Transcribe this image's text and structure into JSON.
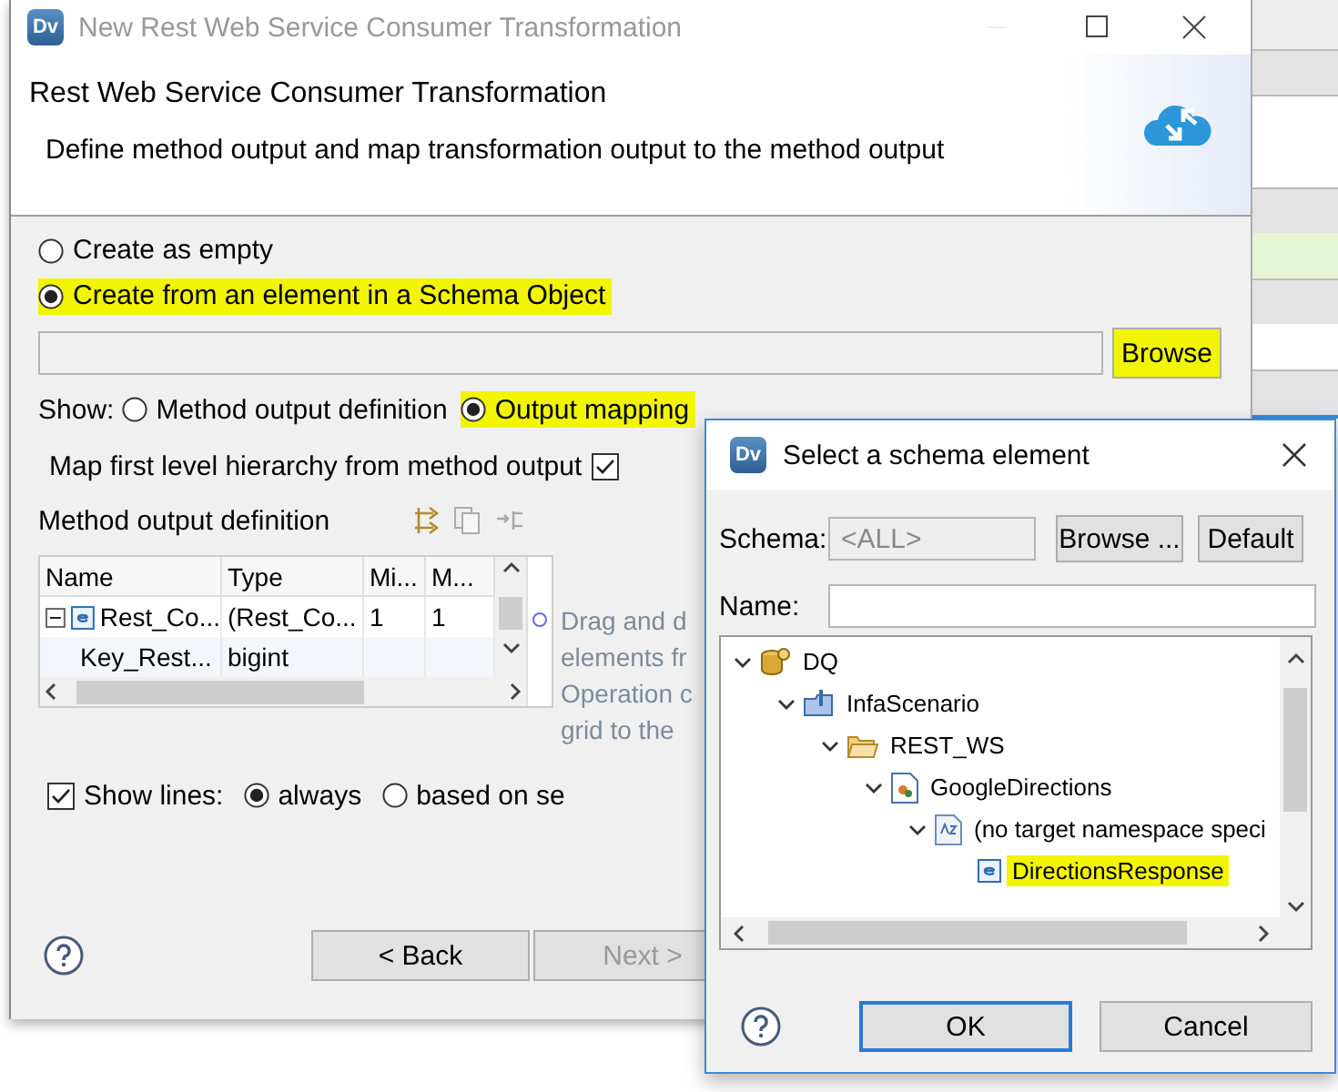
{
  "window": {
    "title": "New Rest Web Service Consumer Transformation",
    "icon": "Dv"
  },
  "header": {
    "title": "Rest Web Service Consumer Transformation",
    "description": "Define method output and map transformation output to the method output"
  },
  "source_options": [
    {
      "label": "Create as empty",
      "selected": false,
      "highlighted": false
    },
    {
      "label": "Create from an element in a Schema Object",
      "selected": true,
      "highlighted": true
    }
  ],
  "browse_button": {
    "label": "Browse",
    "highlighted": true
  },
  "show": {
    "label": "Show:",
    "options": [
      {
        "label": "Method output definition",
        "selected": false,
        "highlighted": false
      },
      {
        "label": "Output mapping",
        "selected": true,
        "highlighted": true
      }
    ]
  },
  "map_first_level": {
    "label": "Map first level hierarchy from method output",
    "checked": true
  },
  "method_output": {
    "title": "Method output definition",
    "columns": [
      "Name",
      "Type",
      "Mi...",
      "M..."
    ],
    "rows": [
      {
        "kind": "element",
        "expanded": true,
        "cells": [
          "Rest_Co...",
          "(Rest_Co...",
          "1",
          "1"
        ]
      },
      {
        "kind": "leaf",
        "cells": [
          "Key_Rest...",
          "bigint"
        ]
      }
    ]
  },
  "hint_lines": [
    "Drag and d",
    "elements fr",
    "Operation c",
    "grid to the"
  ],
  "show_lines": {
    "label": "Show lines:",
    "checked": true,
    "options": [
      {
        "label": "always",
        "selected": true
      },
      {
        "label": "based on se",
        "selected": false
      }
    ]
  },
  "footer": {
    "buttons": [
      {
        "label": "< Back",
        "disabled": false
      },
      {
        "label": "Next >",
        "disabled": true
      }
    ]
  },
  "schema_dialog": {
    "title": "Select a schema element",
    "icon": "Dv",
    "schema_label": "Schema:",
    "schema_value": "<ALL>",
    "browse_label": "Browse ...",
    "default_label": "Default",
    "name_label": "Name:",
    "tree": [
      {
        "label": "DQ",
        "kind": "project",
        "expanded": true,
        "selected": false,
        "highlighted": false,
        "children": [
          {
            "label": "InfaScenario",
            "kind": "folder-info",
            "expanded": true,
            "selected": false,
            "highlighted": false,
            "children": [
              {
                "label": "REST_WS",
                "kind": "folder",
                "expanded": true,
                "selected": false,
                "highlighted": false,
                "children": [
                  {
                    "label": "GoogleDirections",
                    "kind": "schema",
                    "expanded": true,
                    "selected": false,
                    "highlighted": false,
                    "children": [
                      {
                        "label": "(no target namespace speci",
                        "kind": "namespace",
                        "expanded": true,
                        "selected": false,
                        "highlighted": false,
                        "children": [
                          {
                            "label": "DirectionsResponse",
                            "kind": "element",
                            "selected": true,
                            "highlighted": true
                          }
                        ]
                      }
                    ]
                  }
                ]
              }
            ]
          }
        ]
      }
    ],
    "buttons": [
      {
        "label": "OK",
        "default": true
      },
      {
        "label": "Cancel",
        "default": false
      }
    ]
  }
}
